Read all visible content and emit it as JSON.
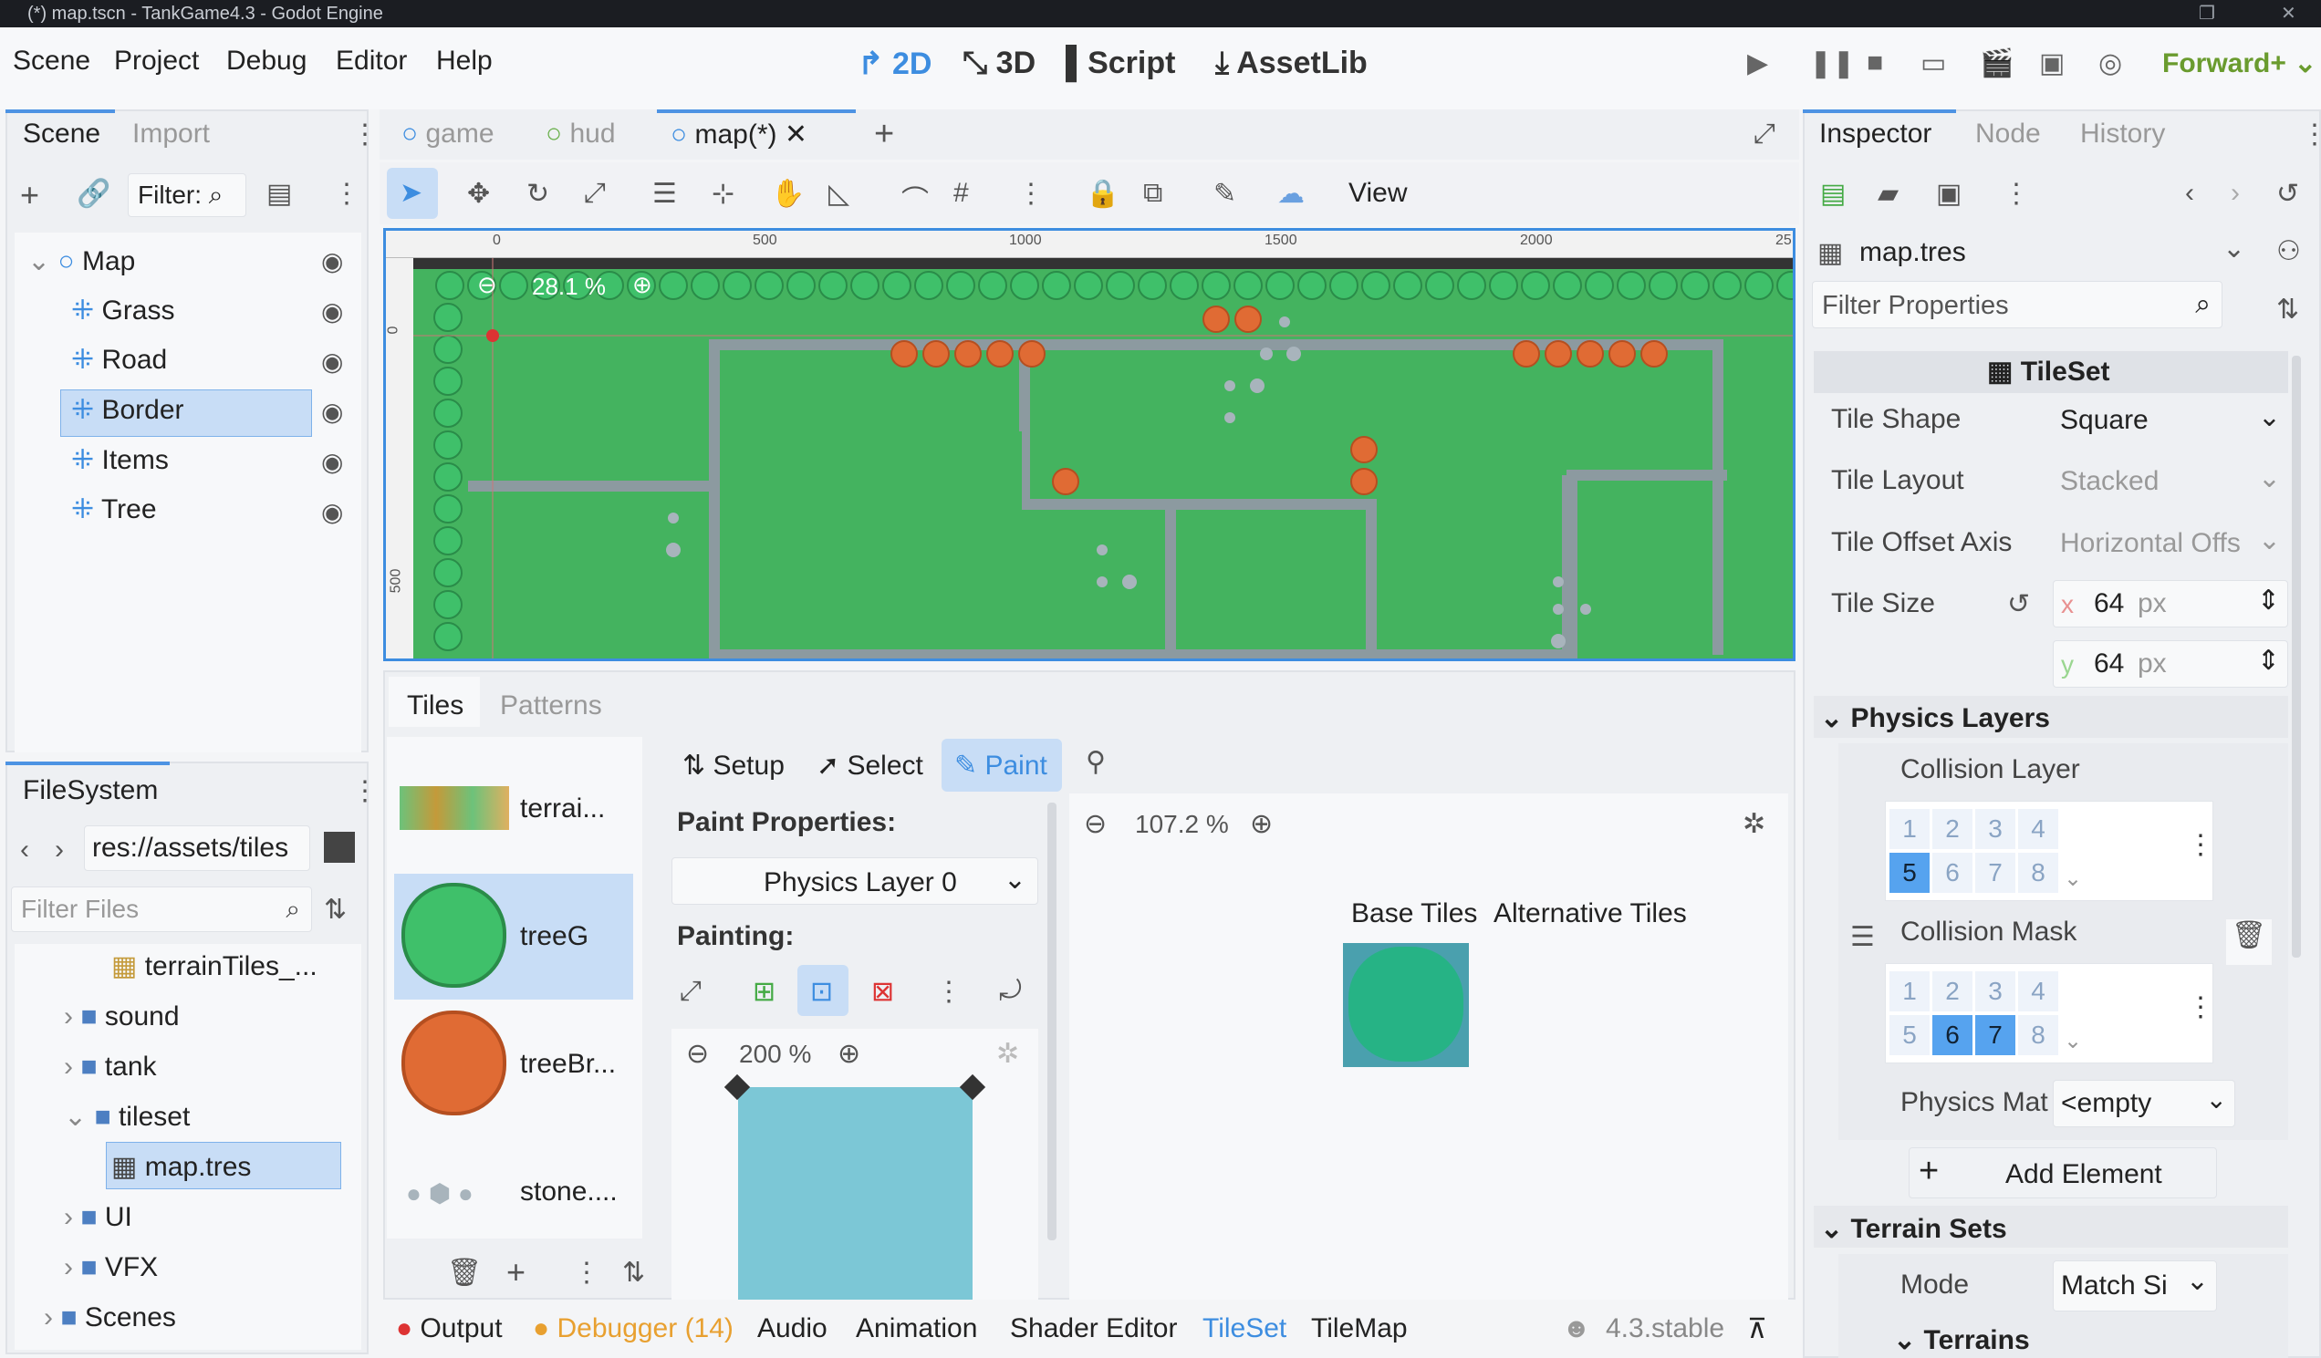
{
  "window": {
    "title": "(*) map.tscn - TankGame4.3 - Godot Engine"
  },
  "menu": {
    "items": [
      "Scene",
      "Project",
      "Debug",
      "Editor",
      "Help"
    ]
  },
  "modes": {
    "d2": "2D",
    "d3": "3D",
    "script": "Script",
    "assetlib": "AssetLib"
  },
  "renderer": "Forward+",
  "scene_dock": {
    "tabs": [
      "Scene",
      "Import"
    ],
    "filter": "Filter:",
    "nodes": [
      {
        "label": "Map"
      },
      {
        "label": "Grass"
      },
      {
        "label": "Road"
      },
      {
        "label": "Border"
      },
      {
        "label": "Items"
      },
      {
        "label": "Tree"
      }
    ]
  },
  "filesystem": {
    "tab": "FileSystem",
    "path": "res://assets/tiles",
    "filter_placeholder": "Filter Files",
    "items": [
      {
        "label": "terrainTiles_..."
      },
      {
        "label": "sound"
      },
      {
        "label": "tank"
      },
      {
        "label": "tileset"
      },
      {
        "label": "map.tres"
      },
      {
        "label": "UI"
      },
      {
        "label": "VFX"
      },
      {
        "label": "Scenes"
      }
    ]
  },
  "scene_tabs": [
    "game",
    "hud",
    "map(*)"
  ],
  "toolbar": {
    "view": "View"
  },
  "viewport": {
    "zoom": "28.1 %",
    "ruler_h": [
      "0",
      "500",
      "1000",
      "1500",
      "2000",
      "25"
    ],
    "ruler_v": [
      "0",
      "500"
    ]
  },
  "tiles_panel": {
    "tabs": [
      "Tiles",
      "Patterns"
    ],
    "sources": [
      {
        "label": "terrai..."
      },
      {
        "label": "treeG"
      },
      {
        "label": "treeBr..."
      },
      {
        "label": "stone...."
      }
    ],
    "modes": {
      "setup": "Setup",
      "select": "Select",
      "paint": "Paint"
    },
    "paint_properties": "Paint Properties:",
    "property": "Physics Layer 0",
    "painting": "Painting:",
    "preview_zoom": "200 %",
    "atlas_zoom": "107.2 %",
    "base_tiles": "Base Tiles",
    "alt_tiles": "Alternative Tiles"
  },
  "bottom": {
    "tabs": [
      "Output",
      "Debugger (14)",
      "Audio",
      "Animation",
      "Shader Editor",
      "TileSet",
      "TileMap"
    ],
    "version": "4.3.stable"
  },
  "inspector": {
    "tabs": [
      "Inspector",
      "Node",
      "History"
    ],
    "resource": "map.tres",
    "filter": "Filter Properties",
    "class": "TileSet",
    "tile_shape": {
      "label": "Tile Shape",
      "value": "Square"
    },
    "tile_layout": {
      "label": "Tile Layout",
      "value": "Stacked"
    },
    "tile_offset": {
      "label": "Tile Offset Axis",
      "value": "Horizontal Offs"
    },
    "tile_size": {
      "label": "Tile Size",
      "x": "64",
      "y": "64",
      "unit": "px",
      "xl": "x",
      "yl": "y"
    },
    "physics_layers": "Physics Layers",
    "collision_layer": "Collision Layer",
    "collision_mask": "Collision Mask",
    "bits": [
      "1",
      "2",
      "3",
      "4",
      "5",
      "6",
      "7",
      "8"
    ],
    "physics_mat": {
      "label": "Physics Mat",
      "value": "<empty"
    },
    "add_element": "Add Element",
    "terrain_sets": "Terrain Sets",
    "mode": {
      "label": "Mode",
      "value": "Match Si"
    },
    "terrains": "Terrains"
  }
}
